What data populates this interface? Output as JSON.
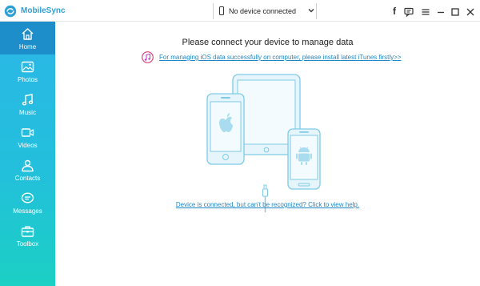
{
  "app": {
    "title": "MobileSync"
  },
  "device_selector": {
    "label": "No device connected"
  },
  "window_controls": {
    "facebook_label": "f"
  },
  "sidebar": {
    "items": [
      {
        "label": "Home",
        "icon": "home-icon",
        "active": true
      },
      {
        "label": "Photos",
        "icon": "photos-icon"
      },
      {
        "label": "Music",
        "icon": "music-icon"
      },
      {
        "label": "Videos",
        "icon": "videos-icon"
      },
      {
        "label": "Contacts",
        "icon": "contacts-icon"
      },
      {
        "label": "Messages",
        "icon": "messages-icon"
      },
      {
        "label": "Toolbox",
        "icon": "toolbox-icon"
      }
    ]
  },
  "main": {
    "heading": "Please connect your device to manage data",
    "itunes_link": "For managing iOS data successfully on computer, please install latest iTunes firstly>>",
    "help_link": "Device is connected, but can't be recognized? Click to view help."
  },
  "colors": {
    "accent": "#2ea0d6",
    "sidebar_top": "#2cb7e8",
    "sidebar_bottom": "#1bd0c4",
    "sidebar_active": "#1d8ec9",
    "link": "#1e88c8",
    "illustration_line": "#7fcbe6",
    "illustration_fill": "#e6f5fb"
  }
}
